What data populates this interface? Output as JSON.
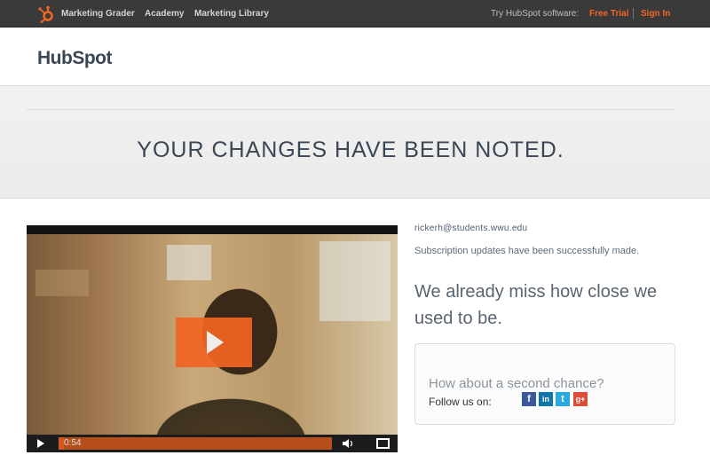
{
  "topbar": {
    "logo_icon": "hubspot-sprocket-icon",
    "nav": [
      "Marketing Grader",
      "Academy",
      "Marketing Library"
    ],
    "try_text": "Try HubSpot software:",
    "free_trial": "Free Trial",
    "sign_in": "Sign In",
    "accent": "#f26522"
  },
  "brand": {
    "logo_text": "HubSpot",
    "logo_icon": "hubspot-logo-icon"
  },
  "hero": {
    "title": "YOUR CHANGES HAVE BEEN NOTED."
  },
  "video": {
    "play_icon": "play-icon",
    "time": "0:54",
    "volume_icon": "volume-icon",
    "fullscreen_icon": "fullscreen-icon"
  },
  "account": {
    "email": "rickerh@students.wwu.edu",
    "status": "Subscription updates have been successfully made."
  },
  "message": {
    "headline": "We already miss how close we used to be."
  },
  "second_chance": {
    "question": "How about a second chance?",
    "follow_label": "Follow us on:",
    "social": [
      {
        "icon": "facebook-icon",
        "glyph": "f",
        "color": "#3b5998"
      },
      {
        "icon": "linkedin-icon",
        "glyph": "in",
        "color": "#0e76a8"
      },
      {
        "icon": "twitter-icon",
        "glyph": "t",
        "color": "#2aa9e0"
      },
      {
        "icon": "google-plus-icon",
        "glyph": "g+",
        "color": "#dd4b39"
      }
    ]
  }
}
